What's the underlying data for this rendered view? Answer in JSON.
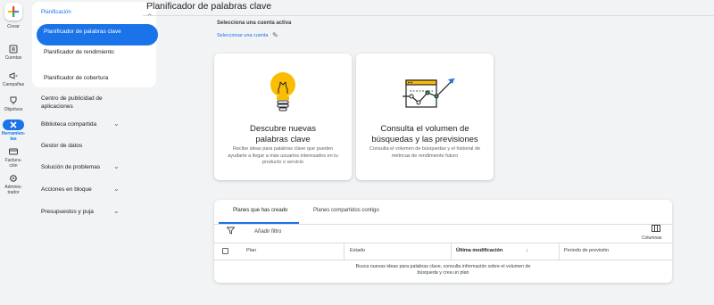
{
  "rail": {
    "create_label": "Crear",
    "items": [
      {
        "label": "Cuentas"
      },
      {
        "label": "Campañas"
      },
      {
        "label": "Objetivos"
      },
      {
        "label": "Herramien-\ntas"
      },
      {
        "label": "Factura-\nción"
      },
      {
        "label": "Adminis-\ntrador"
      }
    ]
  },
  "nav": {
    "section_title": "Planificación",
    "sub_items": [
      {
        "label": "Planificador de palabras clave"
      },
      {
        "label": "Planificador de rendimiento"
      },
      {
        "label": "Planificador de cobertura"
      }
    ],
    "items": [
      {
        "label": "Centro de publicidad de aplicaciones"
      },
      {
        "label": "Biblioteca compartida"
      },
      {
        "label": "Gestor de datos"
      },
      {
        "label": "Solución de problemas"
      },
      {
        "label": "Acciones en bloque"
      },
      {
        "label": "Presupuestos y puja"
      }
    ]
  },
  "header": {
    "title": "Planificador de palabras clave"
  },
  "account": {
    "label": "Selecciona una cuenta activa",
    "link": "Seleccionar una cuenta"
  },
  "cards": [
    {
      "title": "Descubre nuevas palabras clave",
      "description": "Recibe ideas para palabras clave que pueden ayudarte a llegar a más usuarios interesados en tu producto o servicio"
    },
    {
      "title": "Consulta el volumen de búsquedas y las previsiones",
      "description": "Consulta el volumen de búsquedas y el historial de métricas de rendimiento futuro"
    }
  ],
  "table": {
    "tabs": [
      "Planes que has creado",
      "Planes compartidos contigo"
    ],
    "add_filter": "Añadir filtro",
    "columns_label": "Columnas",
    "columns": [
      "Plan",
      "Estado",
      "Última modificación",
      "Periodo de previsión"
    ],
    "sort_arrow": "↓",
    "empty_message": "Busca nuevas ideas para palabras clave, consulta información sobre el volumen de búsqueda y crea un plan"
  },
  "colors": {
    "accent": "#1a73e8",
    "bulb": "#fbbc04",
    "chart_green": "#34a853"
  }
}
